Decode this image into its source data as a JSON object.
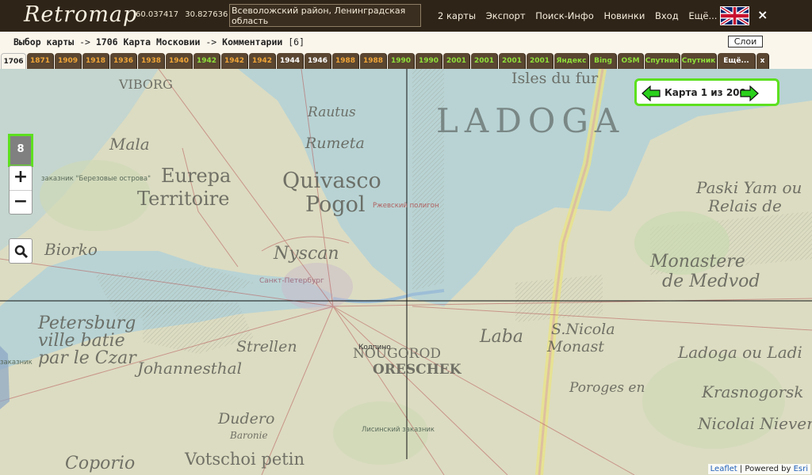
{
  "header": {
    "logo_text": "Retromap",
    "lat": "60.037417",
    "lon": "30.827636",
    "location_text": "Всеволожский район, Ленинградская область",
    "nav": [
      "2 карты",
      "Экспорт",
      "Поиск-Инфо",
      "Новинки",
      "Вход",
      "Ещё..."
    ],
    "close_label": "×"
  },
  "breadcrumb": {
    "part1": "Выбор карты",
    "sep1": " -> ",
    "part2": "1706 Карта Московии",
    "sep2": " -> ",
    "part3": "Комментарии",
    "count": " [6]",
    "layers_label": "Слои"
  },
  "tabs": [
    {
      "label": "1706",
      "style": "active"
    },
    {
      "label": "1871",
      "style": "orange"
    },
    {
      "label": "1909",
      "style": "orange"
    },
    {
      "label": "1918",
      "style": "orange"
    },
    {
      "label": "1936",
      "style": "orange"
    },
    {
      "label": "1938",
      "style": "orange"
    },
    {
      "label": "1940",
      "style": "orange"
    },
    {
      "label": "1942",
      "style": "green"
    },
    {
      "label": "1942",
      "style": "orange"
    },
    {
      "label": "1942",
      "style": "orange"
    },
    {
      "label": "1944",
      "style": "white"
    },
    {
      "label": "1946",
      "style": "white"
    },
    {
      "label": "1988",
      "style": "orange"
    },
    {
      "label": "1988",
      "style": "orange"
    },
    {
      "label": "1990",
      "style": "green"
    },
    {
      "label": "1990",
      "style": "green"
    },
    {
      "label": "2001",
      "style": "green"
    },
    {
      "label": "2001",
      "style": "green"
    },
    {
      "label": "2001",
      "style": "green"
    },
    {
      "label": "2001",
      "style": "green"
    },
    {
      "label": "Яндекс",
      "style": "green"
    },
    {
      "label": "Bing",
      "style": "green"
    },
    {
      "label": "OSM",
      "style": "green"
    },
    {
      "label": "Спутник",
      "style": "green"
    },
    {
      "label": "Спутник",
      "style": "green"
    },
    {
      "label": "Ещё...",
      "style": "white"
    },
    {
      "label": "x",
      "style": "white"
    }
  ],
  "map": {
    "zoom_level": "8",
    "zoom_in": "+",
    "zoom_out": "−",
    "counter_text": "Карта 1 из 200",
    "attribution_leaflet": "Leaflet",
    "attribution_sep": " | Powered by ",
    "attribution_esri": "Esri",
    "labels": {
      "ladoga": "LADOGA",
      "isles": "Isles du fur",
      "viborg": "VIBORG",
      "rautus": "Rautus",
      "rumeta": "Rumeta",
      "mala": "Mala",
      "europa": "Eurepa",
      "territoire": "Territoire",
      "quivasco": "Quivasco",
      "pogol": "Pogol",
      "biorko": "Biorko",
      "nyscan": "Nyscan",
      "petersburg": "Petersburg",
      "villebatie": "ville batie",
      "parleczar": "par le Czar",
      "johannesthal": "Johannesthal",
      "strellen": "Strellen",
      "krasnogorsk": "Krasnogorsk",
      "coporio": "Coporio",
      "votschoi": "Votschoi petin",
      "laba": "Laba",
      "snicola": "S.Nicola",
      "monast": "Monast",
      "ladogaladi": "Ladoga ou Ladi",
      "monastere": "Monastere",
      "demedvod": "de Medvod",
      "paskiyam": "Paski Yam ou",
      "relaisde": "Relais de",
      "nicolai": "Nicolai Nievers",
      "porogesen": "Poroges en",
      "dudero": "Dudero",
      "baronie": "Baronie",
      "spb": "Санкт-Петербург",
      "kolpino": "Колпино",
      "rzhev": "Ржевский полигон",
      "zakaznik": "заказник \"Березовые острова\"",
      "zakaznik2": "заказник",
      "lisinsky": "Лисинский заказник",
      "oreschek": "ORESCHEK",
      "nogorod": "NOUGOROD"
    }
  }
}
